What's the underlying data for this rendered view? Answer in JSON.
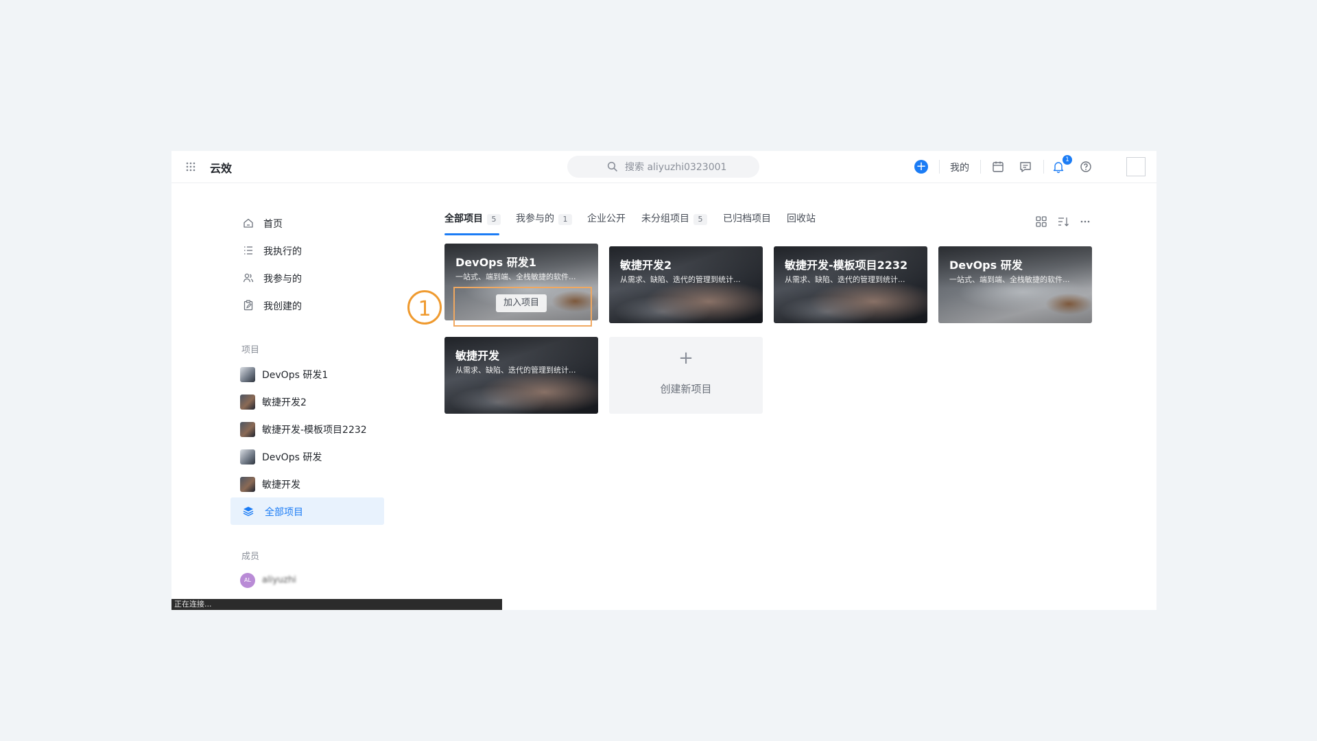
{
  "app": {
    "brand": "云效"
  },
  "search": {
    "placeholder": "搜索 aliyuzhi0323001"
  },
  "header": {
    "my_label": "我的",
    "notification_count": "1"
  },
  "sidebar": {
    "nav": [
      {
        "label": "首页",
        "icon": "home-icon"
      },
      {
        "label": "我执行的",
        "icon": "checklist-icon"
      },
      {
        "label": "我参与的",
        "icon": "people-icon"
      },
      {
        "label": "我创建的",
        "icon": "clipboard-edit-icon"
      }
    ],
    "projects_title": "项目",
    "projects": [
      {
        "label": "DevOps 研发1"
      },
      {
        "label": "敏捷开发2"
      },
      {
        "label": "敏捷开发-模板项目2232"
      },
      {
        "label": "DevOps 研发"
      },
      {
        "label": "敏捷开发"
      }
    ],
    "all_projects_label": "全部项目",
    "members_title": "成员",
    "member": {
      "initials": "AL",
      "name": "aliyuzhi"
    }
  },
  "tabs": [
    {
      "label": "全部项目",
      "count": "5",
      "active": true
    },
    {
      "label": "我参与的",
      "count": "1"
    },
    {
      "label": "企业公开"
    },
    {
      "label": "未分组项目",
      "count": "5"
    },
    {
      "label": "已归档项目"
    },
    {
      "label": "回收站"
    }
  ],
  "cards": [
    {
      "title": "DevOps 研发1",
      "desc": "一站式、端到端、全栈敏捷的软件...",
      "action": "加入项目"
    },
    {
      "title": "敏捷开发2",
      "desc": "从需求、缺陷、迭代的管理到统计..."
    },
    {
      "title": "敏捷开发-模板项目2232",
      "desc": "从需求、缺陷、迭代的管理到统计..."
    },
    {
      "title": "DevOps 研发",
      "desc": "一站式、端到端、全栈敏捷的软件..."
    },
    {
      "title": "敏捷开发",
      "desc": "从需求、缺陷、迭代的管理到统计..."
    }
  ],
  "create_card": {
    "plus": "+",
    "label": "创建新项目"
  },
  "status_bar": {
    "text": "正在连接..."
  },
  "annotation": {
    "step": "1"
  },
  "colors": {
    "accent": "#1b7cf5",
    "annotation": "#ef9a2f",
    "active_bg": "#e8f2fd"
  }
}
